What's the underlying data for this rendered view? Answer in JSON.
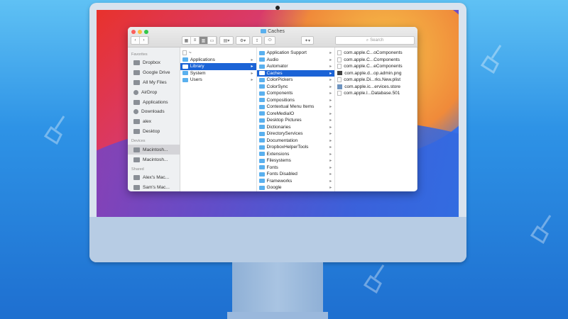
{
  "window": {
    "title": "Caches",
    "search_placeholder": "Search"
  },
  "sidebar": {
    "favorites_header": "Favorites",
    "favorites": [
      {
        "label": "Dropbox",
        "icon": "dropbox-icon"
      },
      {
        "label": "Google Drive",
        "icon": "drive-icon"
      },
      {
        "label": "All My Files",
        "icon": "files-icon"
      },
      {
        "label": "AirDrop",
        "icon": "airdrop-icon"
      },
      {
        "label": "Applications",
        "icon": "applications-icon"
      },
      {
        "label": "Downloads",
        "icon": "downloads-icon"
      },
      {
        "label": "alex",
        "icon": "home-icon"
      },
      {
        "label": "Desktop",
        "icon": "desktop-icon"
      }
    ],
    "devices_header": "Devices",
    "devices": [
      {
        "label": "Macintosh...",
        "icon": "disk-icon"
      },
      {
        "label": "Macintosh...",
        "icon": "disk-icon"
      }
    ],
    "shared_header": "Shared",
    "shared": [
      {
        "label": "Alex's Mac...",
        "icon": "computer-icon"
      },
      {
        "label": "Sam's Mac...",
        "icon": "computer-icon"
      }
    ]
  },
  "columns": {
    "col1": [
      "~",
      "Applications",
      "Library",
      "System",
      "Users"
    ],
    "col2": [
      "Application Support",
      "Audio",
      "Automator",
      "Caches",
      "ColorPickers",
      "ColorSync",
      "Components",
      "Compositions",
      "Contextual Menu Items",
      "CoreMediaIO",
      "Desktop Pictures",
      "Dictionaries",
      "DirectoryServices",
      "Documentation",
      "DropboxHelperTools",
      "Extensions",
      "Filesystems",
      "Fonts",
      "Fonts Disabled",
      "Frameworks",
      "Google"
    ],
    "col3": [
      "com.apple.C...oComponents",
      "com.apple.C...Components",
      "com.apple.C...eComponents",
      "com.apple.d...op.admin.png",
      "com.apple.Di...rks.New.plist",
      "com.apple.ic...ervices.store",
      "com.apple.l...Database.501"
    ]
  },
  "colors": {
    "selection": "#1b63d6",
    "folder": "#5ab0ee"
  }
}
